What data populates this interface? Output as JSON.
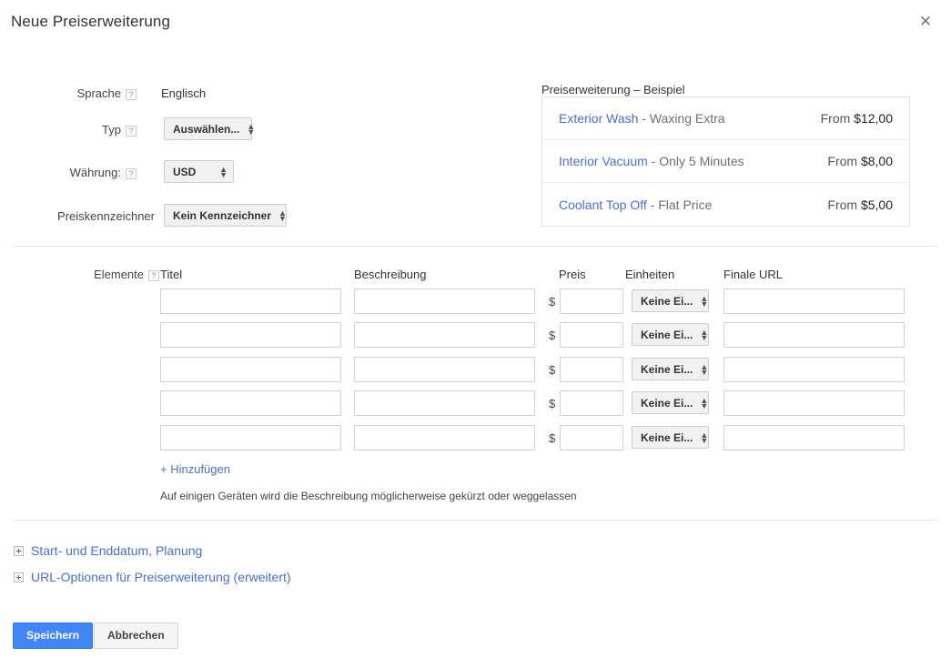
{
  "dialog": {
    "title": "Neue Preiserweiterung",
    "close_icon": "close-icon"
  },
  "form": {
    "language": {
      "label": "Sprache",
      "help": "?",
      "value": "Englisch"
    },
    "type": {
      "label": "Typ",
      "help": "?",
      "value": "Auswählen..."
    },
    "currency": {
      "label": "Währung:",
      "help": "?",
      "value": "USD"
    },
    "price_qualifier": {
      "label": "Preiskennzeichner",
      "value": "Kein Kennzeichner"
    }
  },
  "preview": {
    "title": "Preiserweiterung – Beispiel",
    "rows": [
      {
        "name": "Exterior Wash",
        "dash": " - ",
        "desc": "Waxing Extra",
        "price_prefix": "From ",
        "price": "$12,00"
      },
      {
        "name": "Interior Vacuum",
        "dash": " - ",
        "desc": "Only 5 Minutes",
        "price_prefix": "From ",
        "price": "$8,00"
      },
      {
        "name": "Coolant Top Off",
        "dash": " - ",
        "desc": "Flat Price",
        "price_prefix": "From ",
        "price": "$5,00"
      }
    ]
  },
  "elements": {
    "label": "Elemente",
    "help": "?",
    "columns": {
      "title": "Titel",
      "description": "Beschreibung",
      "price": "Preis",
      "units": "Einheiten",
      "final_url": "Finale URL"
    },
    "currency_symbol": "$",
    "units_value": "Keine Ei...",
    "rows": [
      {
        "title": "",
        "description": "",
        "price": "",
        "units": "Keine Ei...",
        "final_url": ""
      },
      {
        "title": "",
        "description": "",
        "price": "",
        "units": "Keine Ei...",
        "final_url": ""
      },
      {
        "title": "",
        "description": "",
        "price": "",
        "units": "Keine Ei...",
        "final_url": ""
      },
      {
        "title": "",
        "description": "",
        "price": "",
        "units": "Keine Ei...",
        "final_url": ""
      },
      {
        "title": "",
        "description": "",
        "price": "",
        "units": "Keine Ei...",
        "final_url": ""
      }
    ],
    "add_link": "+ Hinzufügen",
    "hint": "Auf einigen Geräten wird die Beschreibung möglicherweise gekürzt oder weggelassen"
  },
  "sections": [
    {
      "label": "Start- und Enddatum, Planung"
    },
    {
      "label": "URL-Optionen für Preiserweiterung (erweitert)"
    }
  ],
  "footer": {
    "save_label": "Speichern",
    "cancel_label": "Abbrechen"
  },
  "colors": {
    "link": "#4b6fce",
    "primary_button": "#4285f4",
    "text": "#222222",
    "muted": "#6f6f6f",
    "border": "#d0d0d0"
  }
}
